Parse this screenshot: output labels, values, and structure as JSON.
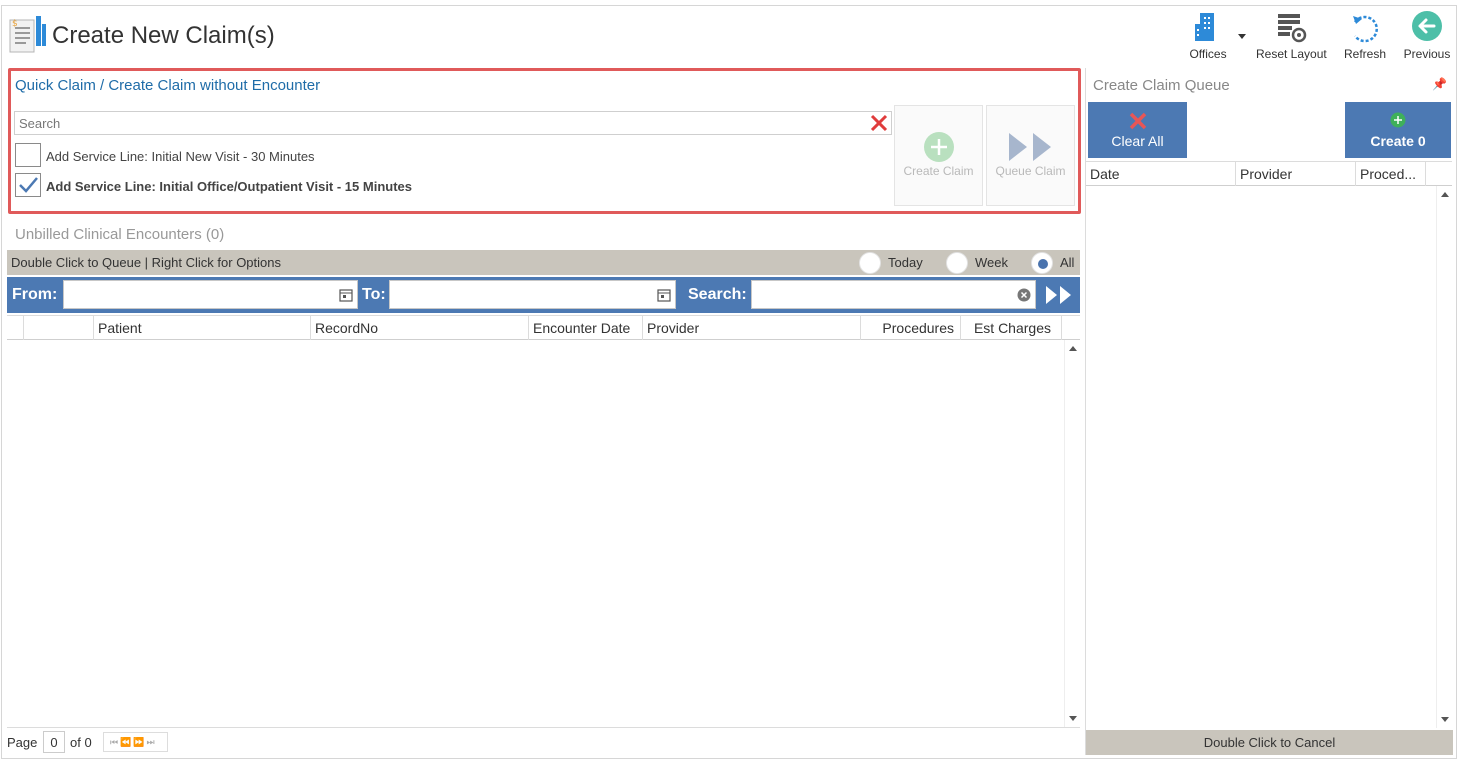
{
  "header": {
    "title": "Create New Claim(s)",
    "toolbar": {
      "offices_label": "Offices",
      "reset_layout_label": "Reset Layout",
      "refresh_label": "Refresh",
      "previous_label": "Previous"
    }
  },
  "quick_claim": {
    "title": "Quick Claim / Create Claim without Encounter",
    "search_placeholder": "Search",
    "search_value": "",
    "items": [
      {
        "label": "Add Service Line: Initial New Visit - 30 Minutes",
        "checked": false
      },
      {
        "label": "Add Service Line: Initial Office/Outpatient Visit - 15 Minutes",
        "checked": true
      }
    ],
    "create_claim_label": "Create Claim",
    "queue_claim_label": "Queue Claim"
  },
  "unbilled": {
    "title": "Unbilled Clinical Encounters (0)",
    "hint": "Double Click to Queue | Right Click for Options",
    "ranges": [
      {
        "label": "Today",
        "selected": false
      },
      {
        "label": "Week",
        "selected": false
      },
      {
        "label": "All",
        "selected": true
      }
    ],
    "filter": {
      "from_label": "From:",
      "to_label": "To:",
      "search_label": "Search:",
      "from_value": "",
      "to_value": "",
      "search_value": ""
    },
    "columns": [
      "Patient",
      "RecordNo",
      "Encounter Date",
      "Provider",
      "Procedures",
      "Est Charges"
    ],
    "rows": [],
    "pager": {
      "page_label": "Page",
      "page_value": "0",
      "of_label": "of 0"
    }
  },
  "queue": {
    "title": "Create Claim Queue",
    "clear_all_label": "Clear All",
    "create_label": "Create 0",
    "columns": [
      "Date",
      "Provider",
      "Proced..."
    ],
    "rows": [],
    "footer": "Double Click to Cancel"
  },
  "colors": {
    "accent_blue": "#4c79b3",
    "title_blue": "#1f6ca8",
    "highlight_red": "#e05a5a",
    "bar_gray": "#c9c5bc"
  }
}
